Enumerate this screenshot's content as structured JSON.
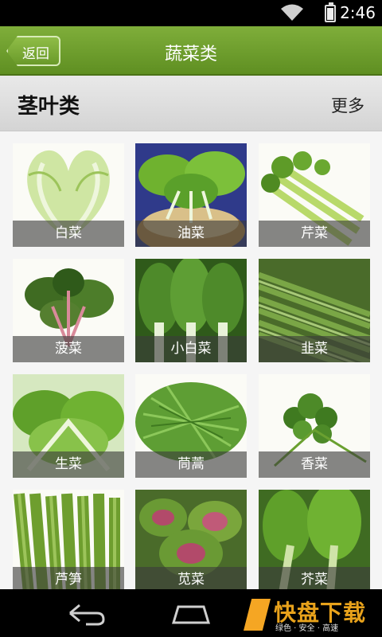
{
  "status_bar": {
    "time": "2:46",
    "battery_level": 0.85
  },
  "header": {
    "back_label": "返回",
    "title": "蔬菜类"
  },
  "section": {
    "title": "茎叶类",
    "more_label": "更多"
  },
  "tiles": [
    {
      "label": "白菜",
      "icon": "chinese-cabbage"
    },
    {
      "label": "油菜",
      "icon": "rape-greens"
    },
    {
      "label": "芹菜",
      "icon": "celery"
    },
    {
      "label": "菠菜",
      "icon": "spinach"
    },
    {
      "label": "小白菜",
      "icon": "bok-choy"
    },
    {
      "label": "韭菜",
      "icon": "chives"
    },
    {
      "label": "生菜",
      "icon": "lettuce"
    },
    {
      "label": "茼蒿",
      "icon": "crown-daisy"
    },
    {
      "label": "香菜",
      "icon": "coriander"
    },
    {
      "label": "芦笋",
      "icon": "asparagus"
    },
    {
      "label": "苋菜",
      "icon": "amaranth"
    },
    {
      "label": "芥菜",
      "icon": "mustard-greens"
    }
  ],
  "watermark": {
    "brand": "快盘下载",
    "tagline": "绿色 · 安全 · 高速"
  },
  "colors": {
    "header_green": "#6b9b2c",
    "caption_bg": "#3c3c3c"
  }
}
